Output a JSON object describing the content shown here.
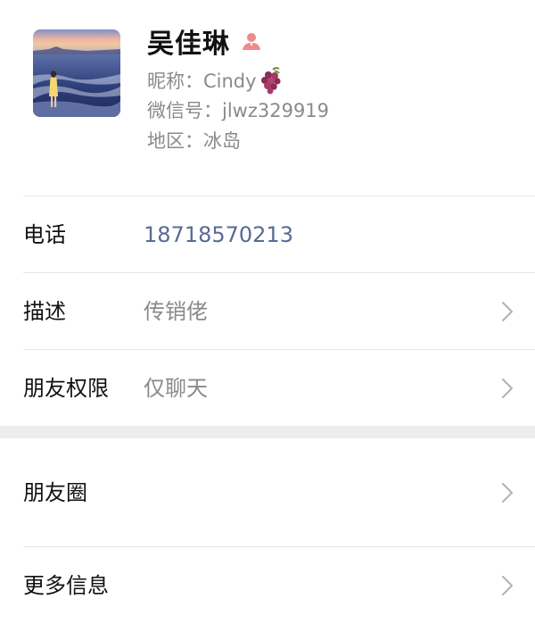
{
  "profile": {
    "name": "吴佳琳",
    "nickname": "昵称：Cindy",
    "wechat_id": "微信号：jlwz329919",
    "region": "地区：冰岛",
    "gender_icon": "person-icon",
    "nickname_emoji": "grape-icon"
  },
  "rows": [
    {
      "label": "电话",
      "value": "18718570213",
      "has_chevron": false
    },
    {
      "label": "描述",
      "value": "传销佬",
      "has_chevron": true
    },
    {
      "label": "朋友权限",
      "value": "仅聊天",
      "has_chevron": true
    }
  ],
  "rows2": [
    {
      "label": "朋友圈",
      "has_chevron": true
    },
    {
      "label": "更多信息",
      "has_chevron": true
    }
  ],
  "colors": {
    "link": "#576b95",
    "secondary_text": "#8a8a8a",
    "divider": "#e6e6e6",
    "section_gap": "#ededed",
    "gender_icon": "#f08a8a"
  }
}
